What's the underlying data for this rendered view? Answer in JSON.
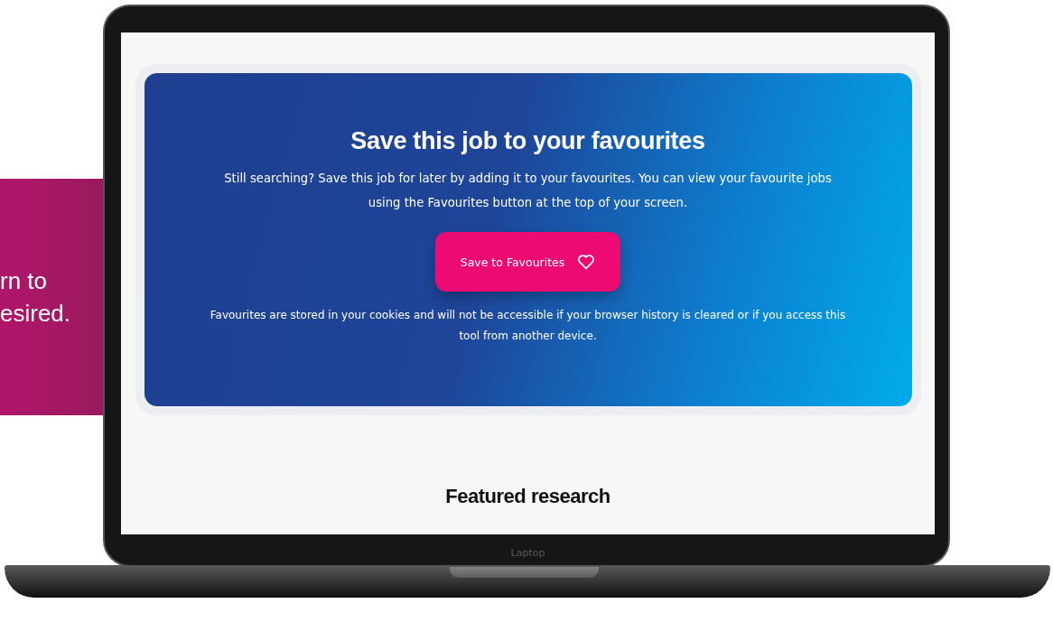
{
  "side_panel": {
    "lines": [
      "rn to",
      "esired."
    ]
  },
  "laptop": {
    "label": "Laptop"
  },
  "favourites_card": {
    "title": "Save this job to your favourites",
    "description": "Still searching? Save this job for later by adding it to your favourites. You can view your favourite jobs using the Favourites button at the top of your screen.",
    "button": "Save to Favourites",
    "note": "Favourites are stored in your cookies and will not be accessible if your browser history is cleared or if you access this tool from another device."
  },
  "section_heading": "Featured research"
}
